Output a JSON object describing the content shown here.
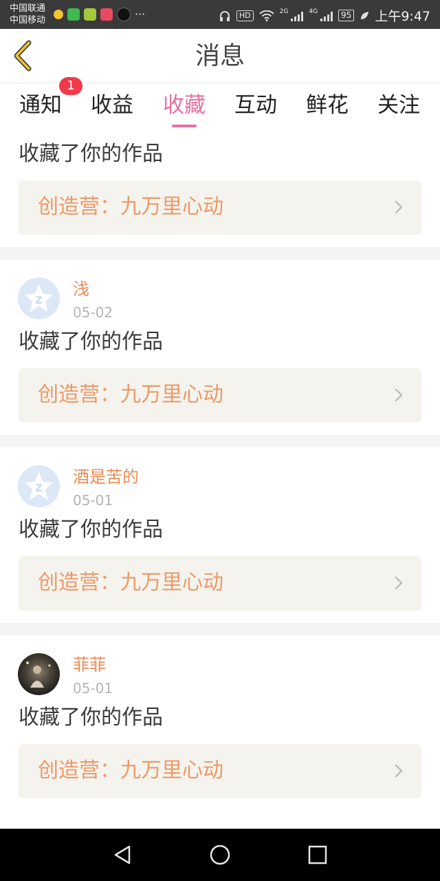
{
  "status_bar": {
    "carrier_1": "中国联通",
    "carrier_2": "中国移动",
    "hd": "HD",
    "net_1": "2G",
    "net_2": "4G",
    "battery": "95",
    "time": "上午9:47",
    "notification_icons": [
      "bulb-icon",
      "video-app-icon",
      "green-app-icon",
      "red-app-icon",
      "tiktok-icon",
      "more-dots-icon"
    ]
  },
  "header": {
    "title": "消息",
    "back_icon": "chevron-left-icon"
  },
  "tabs": {
    "items": [
      {
        "label": "通知",
        "badge": "1"
      },
      {
        "label": "收益"
      },
      {
        "label": "收藏"
      },
      {
        "label": "互动"
      },
      {
        "label": "鲜花"
      },
      {
        "label": "关注"
      }
    ],
    "active": "收藏",
    "accent": "#e86fa3"
  },
  "feed": {
    "first": {
      "action": "收藏了你的作品",
      "work": "创造营：九万里心动"
    },
    "items": [
      {
        "name": "浅",
        "date": "05-02",
        "action": "收藏了你的作品",
        "work": "创造营：九万里心动"
      },
      {
        "name": "酒是苦的",
        "date": "05-01",
        "action": "收藏了你的作品",
        "work": "创造营：九万里心动"
      },
      {
        "name": "菲菲",
        "date": "05-01",
        "action": "收藏了你的作品",
        "work": "创造营：九万里心动"
      }
    ]
  },
  "colors": {
    "name": "#e98c58",
    "work_title": "#ee9966",
    "work_bg": "#f4f3ee"
  },
  "navbar": {
    "icons": [
      "back-triangle-icon",
      "home-circle-icon",
      "recents-square-icon"
    ]
  }
}
